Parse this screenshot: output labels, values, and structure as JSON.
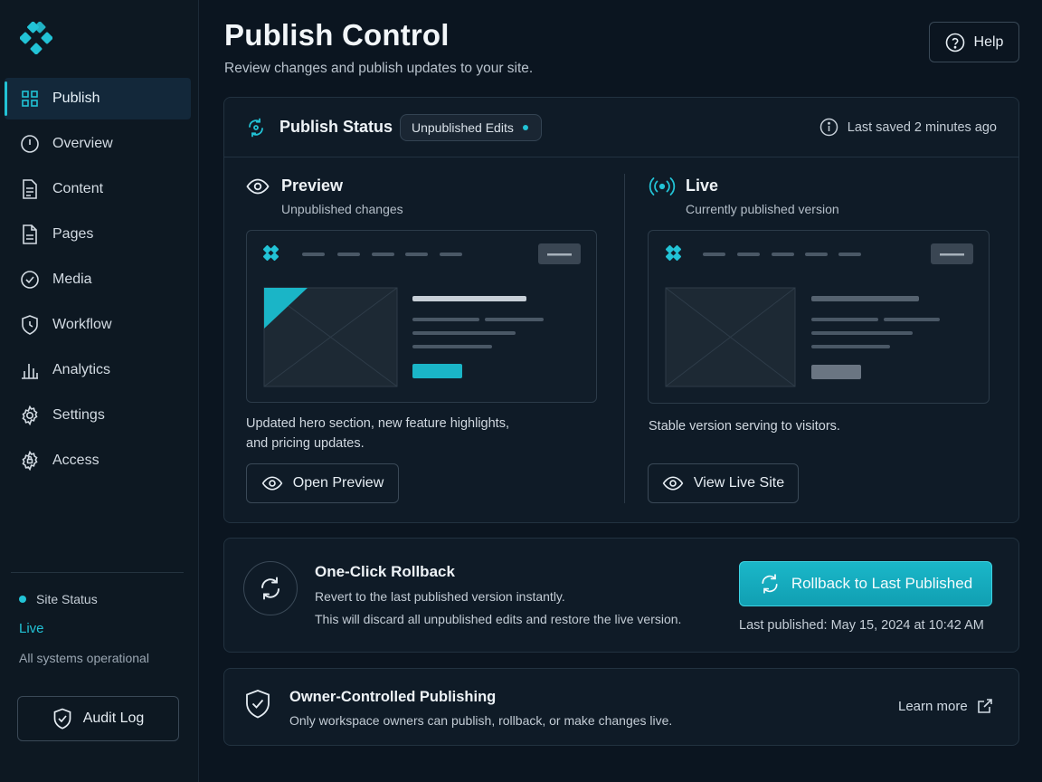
{
  "app": {
    "brand_color": "#22c3d6"
  },
  "sidebar": {
    "items": [
      {
        "label": "Publish",
        "icon": "grid-icon"
      },
      {
        "label": "Overview",
        "icon": "clock-icon"
      },
      {
        "label": "Content",
        "icon": "document-icon"
      },
      {
        "label": "Pages",
        "icon": "page-icon"
      },
      {
        "label": "Media",
        "icon": "check-circle-icon"
      },
      {
        "label": "Workflow",
        "icon": "shield-clock-icon"
      },
      {
        "label": "Analytics",
        "icon": "bar-chart-icon"
      },
      {
        "label": "Settings",
        "icon": "gear-icon"
      },
      {
        "label": "Access",
        "icon": "gear-shield-icon"
      }
    ],
    "site_status_label": "Site Status",
    "site_status_value": "Live",
    "site_status_detail": "All systems operational",
    "audit_log_label": "Audit Log"
  },
  "header": {
    "title": "Publish Control",
    "subtitle": "Review changes and publish updates to your site.",
    "help_label": "Help"
  },
  "status_card": {
    "title": "Publish Status",
    "badge": "Unpublished Edits",
    "last_saved": "Last saved 2 minutes ago",
    "preview": {
      "title": "Preview",
      "subtitle": "Unpublished changes",
      "description_line1": "Updated hero section, new feature highlights,",
      "description_line2": "and pricing updates.",
      "button_label": "Open Preview"
    },
    "live": {
      "title": "Live",
      "subtitle": "Currently published version",
      "description": "Stable version serving to visitors.",
      "button_label": "View Live Site"
    }
  },
  "rollback": {
    "title": "One-Click Rollback",
    "line1": "Revert to the last published version instantly.",
    "line2": "This will discard all unpublished edits and restore the live version.",
    "button_label": "Rollback to Last Published",
    "last_published": "Last published: May 15, 2024 at 10:42 AM"
  },
  "owner": {
    "title": "Owner-Controlled Publishing",
    "subtitle": "Only workspace owners can publish, rollback, or make changes live.",
    "learn_more": "Learn more"
  }
}
